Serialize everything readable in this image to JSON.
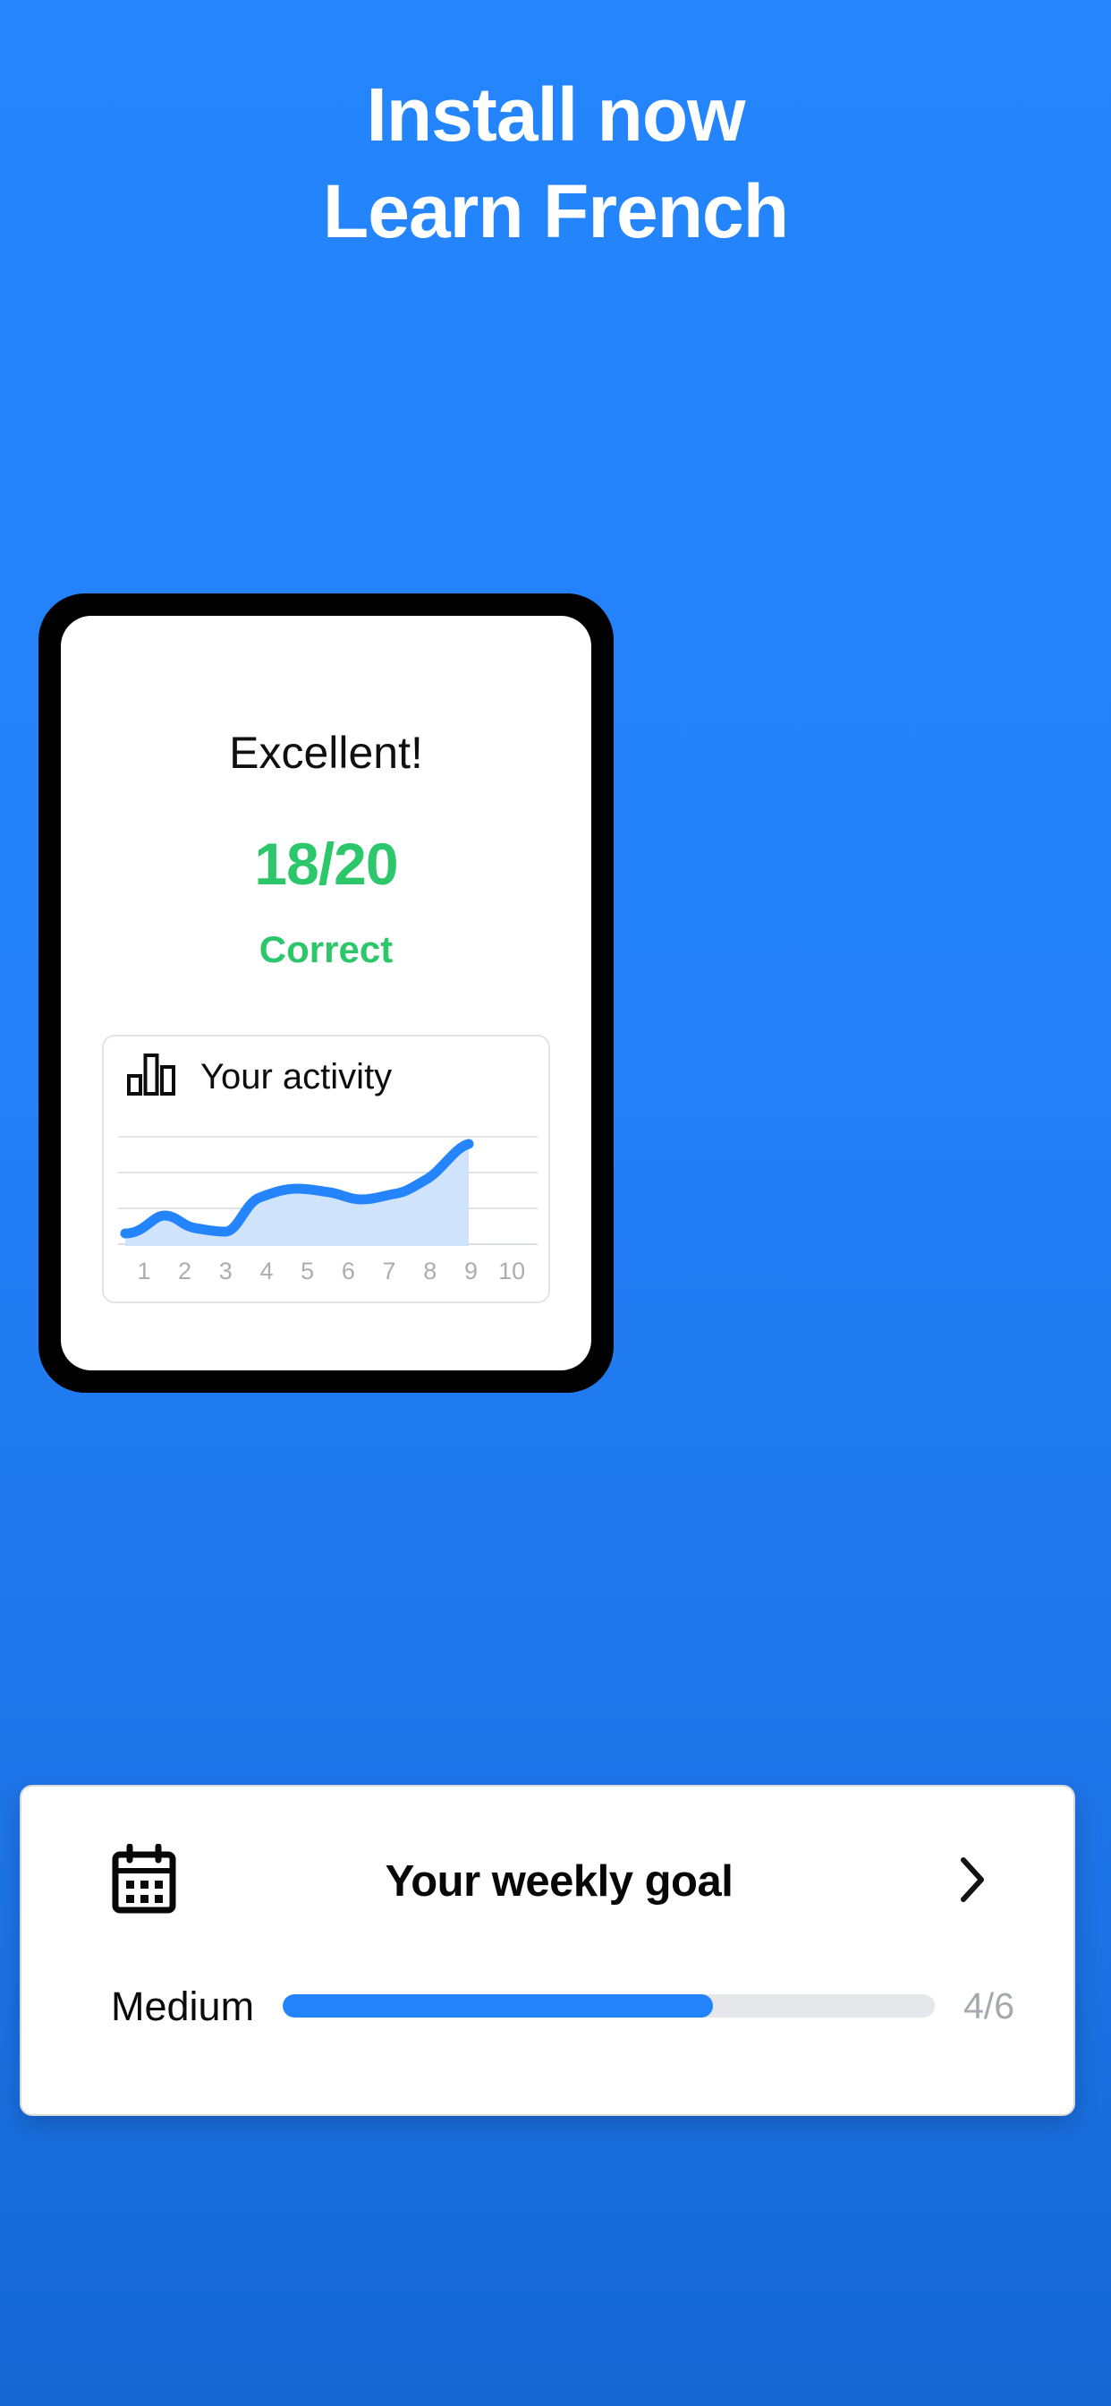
{
  "headline": {
    "line1": "Install now",
    "line2": "Learn French"
  },
  "colors": {
    "bg_top": "#2485FD",
    "bg_bottom": "#1567D4",
    "accent_blue": "#2484FC",
    "success_green": "#2CC76A",
    "muted_gray": "#ADADAD",
    "track_gray": "#E5E7EA"
  },
  "screen": {
    "result": {
      "title": "Excellent!",
      "score": "18/20",
      "score_label": "Correct"
    },
    "activity_card": {
      "icon": "bar-chart-icon",
      "title": "Your activity"
    }
  },
  "weekly_goal": {
    "icon": "calendar-icon",
    "title": "Your weekly goal",
    "chevron": "chevron-right-icon",
    "level": "Medium",
    "count": "4/6",
    "progress_percent": 66
  },
  "chart_data": {
    "type": "area",
    "title": "Your activity",
    "xlabel": "",
    "ylabel": "",
    "categories": [
      "1",
      "2",
      "3",
      "4",
      "5",
      "6",
      "7",
      "8",
      "9",
      "10"
    ],
    "x": [
      1,
      2,
      3,
      4,
      5,
      6,
      7,
      8,
      9,
      10
    ],
    "values": [
      4,
      14,
      9,
      6,
      22,
      40,
      38,
      33,
      46,
      78
    ],
    "ylim": [
      0,
      100
    ],
    "grid": true,
    "gridlines": [
      30,
      55,
      80
    ],
    "legend": "none",
    "line_color": "#2484FC",
    "fill_color": "#CFE3FD"
  }
}
